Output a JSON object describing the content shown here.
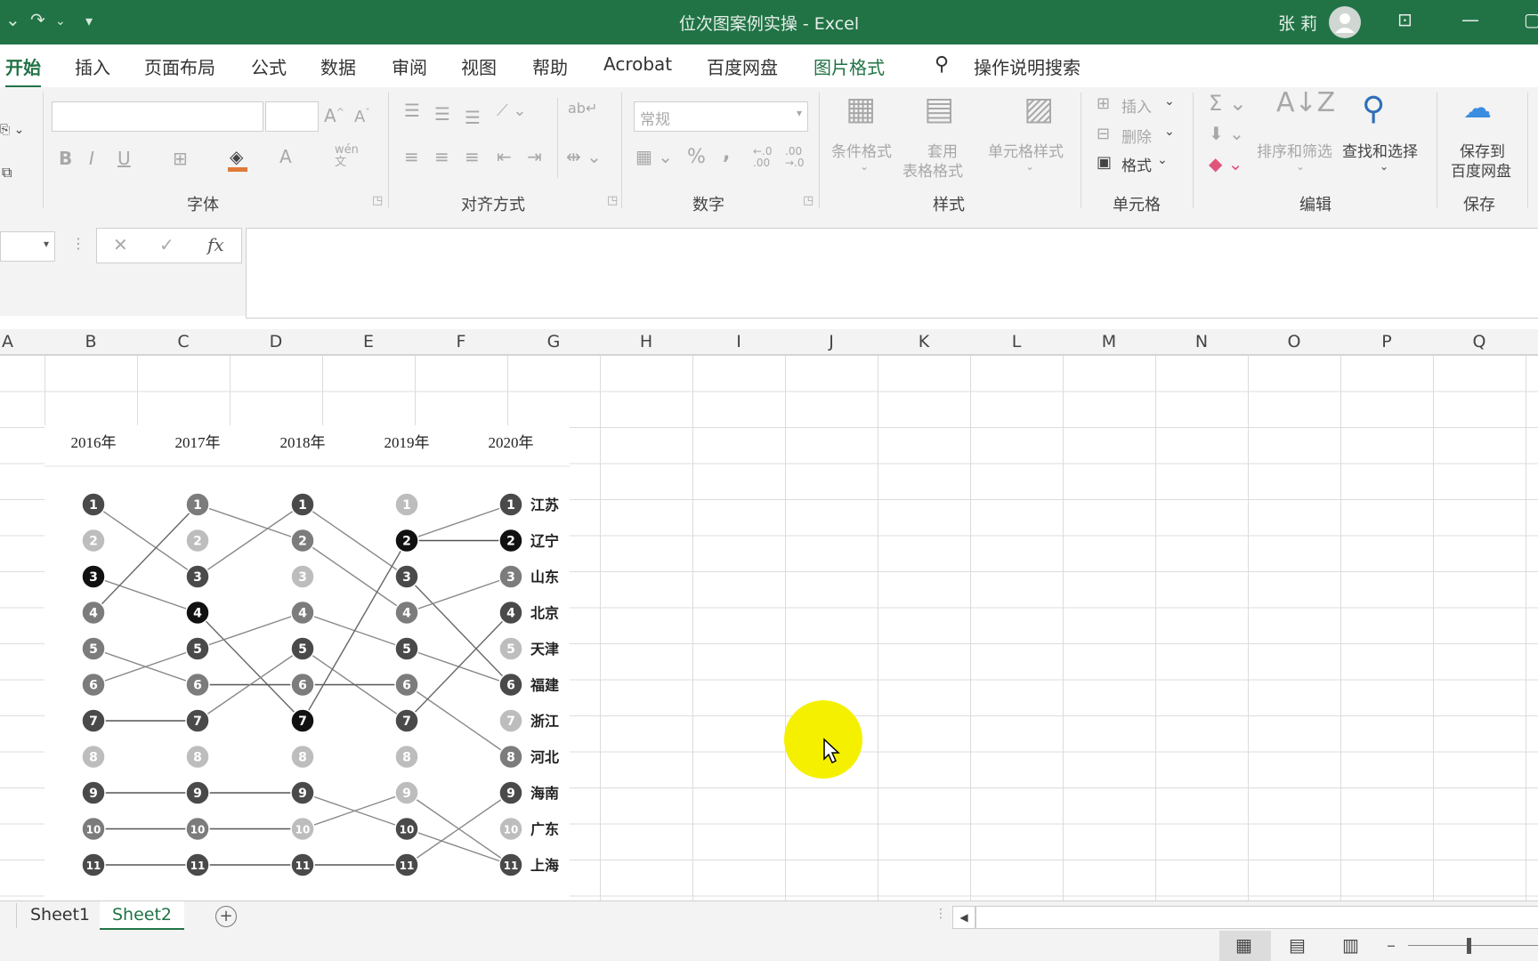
{
  "window": {
    "title": "位次图案例实操  -  Excel",
    "user": "张 莉"
  },
  "tabs": [
    {
      "label": "开始",
      "state": "active"
    },
    {
      "label": "插入"
    },
    {
      "label": "页面布局"
    },
    {
      "label": "公式"
    },
    {
      "label": "数据"
    },
    {
      "label": "审阅"
    },
    {
      "label": "视图"
    },
    {
      "label": "帮助"
    },
    {
      "label": "Acrobat"
    },
    {
      "label": "百度网盘"
    },
    {
      "label": "图片格式",
      "state": "contextual"
    },
    {
      "label": "操作说明搜索",
      "icon": "lightbulb-icon"
    }
  ],
  "ribbon": {
    "font": {
      "label": "字体",
      "bold": "B",
      "italic": "I",
      "underline": "U",
      "font_color_glyph": "A",
      "phonetic": "wén\n文"
    },
    "alignment": {
      "label": "对齐方式"
    },
    "number": {
      "label": "数字",
      "format_value": "常规",
      "percent": "%",
      "comma": ",",
      "inc_dec": "←.0\n.00",
      "dec_dec": ".00\n→.0"
    },
    "styles": {
      "label": "样式",
      "conditional": "条件格式",
      "table_line1": "套用",
      "table_line2": "表格格式",
      "cell_styles": "单元格样式"
    },
    "cells": {
      "label": "单元格",
      "insert": "插入",
      "delete": "删除",
      "format": "格式"
    },
    "editing": {
      "label": "编辑",
      "sort_filter": "排序和筛选",
      "find_select": "查找和选择"
    },
    "save": {
      "label": "保存",
      "save_line1": "保存到",
      "save_line2": "百度网盘"
    }
  },
  "formula_bar": {
    "cancel": "✕",
    "enter": "✓",
    "fx": "fx",
    "value": ""
  },
  "columns": [
    "A",
    "B",
    "C",
    "D",
    "E",
    "F",
    "G",
    "H",
    "I",
    "J",
    "K",
    "L",
    "M",
    "N",
    "O",
    "P",
    "Q"
  ],
  "sheets": [
    {
      "name": "Sheet1"
    },
    {
      "name": "Sheet2",
      "active": true
    }
  ],
  "chart_data": {
    "type": "bump",
    "years": [
      "2016年",
      "2017年",
      "2018年",
      "2019年",
      "2020年"
    ],
    "rank_labels": [
      "1",
      "2",
      "3",
      "4",
      "5",
      "6",
      "7",
      "8",
      "9",
      "10",
      "11"
    ],
    "provinces_by_2020_rank": [
      "江苏",
      "辽宁",
      "山东",
      "北京",
      "天津",
      "福建",
      "浙江",
      "河北",
      "海南",
      "广东",
      "上海"
    ],
    "colors": {
      "black": "#111111",
      "dark": "#4a4a4a",
      "mid": "#7c7c7c",
      "light": "#bdbdbd"
    },
    "connections": [
      {
        "from_year": "2016年",
        "pairs": [
          [
            1,
            3
          ],
          [
            3,
            4
          ],
          [
            4,
            1
          ],
          [
            5,
            6
          ],
          [
            6,
            5
          ],
          [
            7,
            7
          ],
          [
            9,
            9
          ],
          [
            10,
            10
          ],
          [
            11,
            11
          ]
        ]
      },
      {
        "from_year": "2017年",
        "pairs": [
          [
            1,
            2
          ],
          [
            3,
            1
          ],
          [
            4,
            7
          ],
          [
            5,
            4
          ],
          [
            6,
            6
          ],
          [
            7,
            5
          ],
          [
            9,
            9
          ],
          [
            10,
            10
          ],
          [
            11,
            11
          ]
        ]
      },
      {
        "from_year": "2018年",
        "pairs": [
          [
            1,
            3
          ],
          [
            2,
            4
          ],
          [
            4,
            5
          ],
          [
            5,
            7
          ],
          [
            6,
            6
          ],
          [
            7,
            2
          ],
          [
            9,
            10
          ],
          [
            10,
            9
          ],
          [
            11,
            11
          ]
        ]
      },
      {
        "from_year": "2019年",
        "pairs": [
          [
            2,
            2
          ],
          [
            2,
            1
          ],
          [
            3,
            6
          ],
          [
            4,
            3
          ],
          [
            5,
            6
          ],
          [
            6,
            8
          ],
          [
            7,
            4
          ],
          [
            9,
            11
          ],
          [
            10,
            11
          ],
          [
            11,
            9
          ]
        ]
      }
    ]
  }
}
